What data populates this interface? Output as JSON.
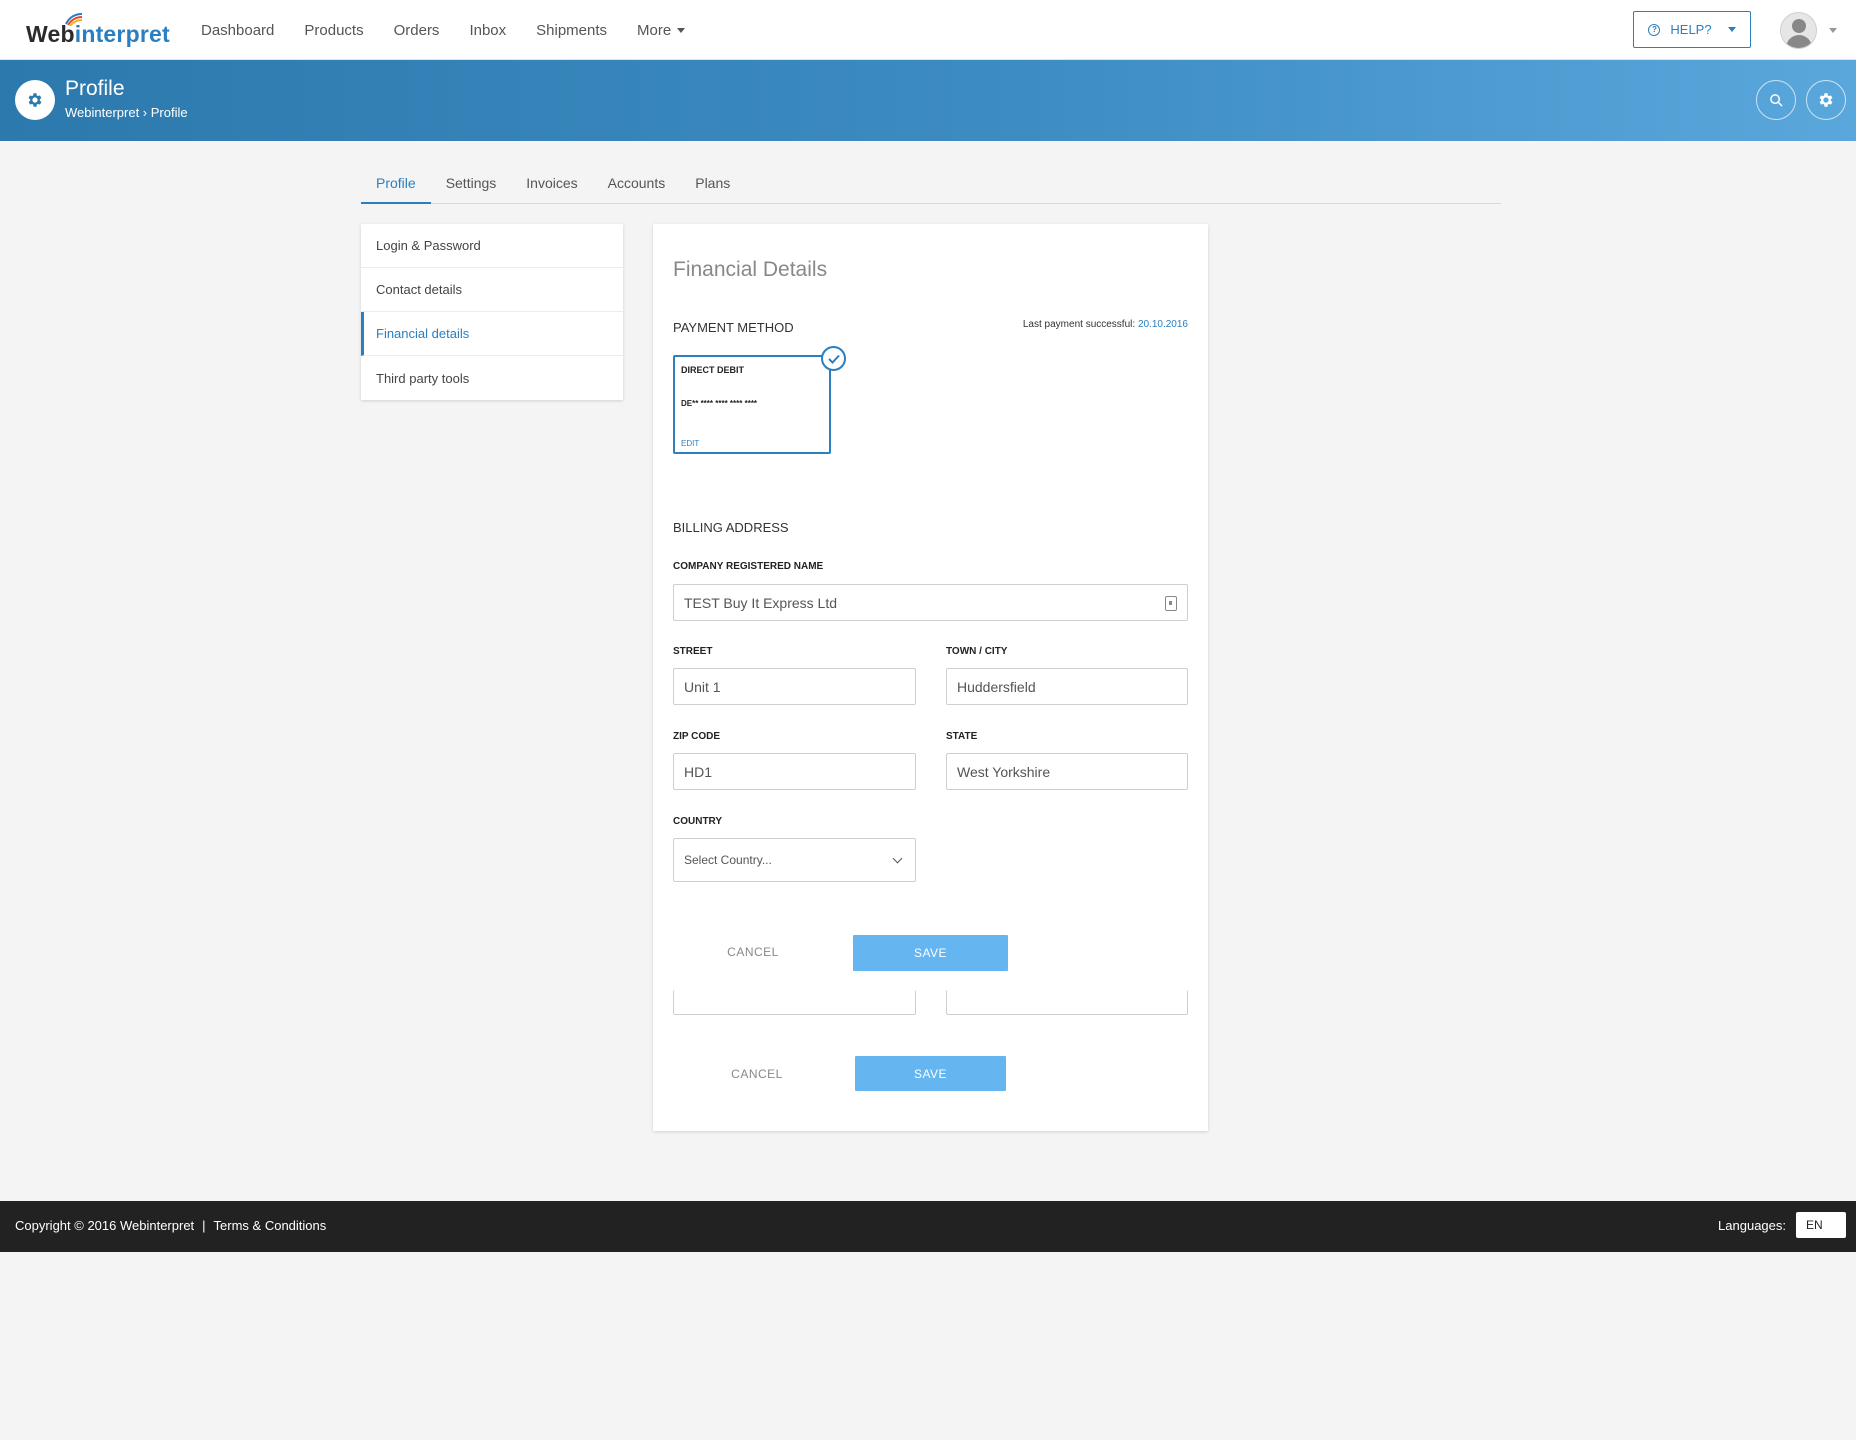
{
  "app": {
    "logo_part1": "Web",
    "logo_part2": "interpret"
  },
  "nav": {
    "items": [
      "Dashboard",
      "Products",
      "Orders",
      "Inbox",
      "Shipments",
      "More"
    ],
    "help_label": "HELP?"
  },
  "header": {
    "title": "Profile",
    "breadcrumb": "Webinterpret › Profile"
  },
  "tabs": [
    "Profile",
    "Settings",
    "Invoices",
    "Accounts",
    "Plans"
  ],
  "active_tab": "Profile",
  "sidebar": {
    "items": [
      {
        "label": "Login & Password"
      },
      {
        "label": "Contact details"
      },
      {
        "label": "Financial details"
      },
      {
        "label": "Third party tools"
      }
    ],
    "active": "Financial details"
  },
  "main": {
    "title": "Financial Details",
    "payment_method_label": "PAYMENT METHOD",
    "last_payment_text": "Last payment successful:",
    "last_payment_date": "20.10.2016",
    "payment_card": {
      "type": "DIRECT DEBIT",
      "number": "DE** **** **** **** ****",
      "edit_label": "EDIT"
    },
    "billing_address_label": "BILLING ADDRESS",
    "fields": {
      "company_label": "COMPANY REGISTERED NAME",
      "company_value": "TEST Buy It Express Ltd",
      "street_label": "STREET",
      "street_value": "Unit 1",
      "town_label": "TOWN / CITY",
      "town_value": "Huddersfield",
      "zip_label": "ZIP CODE",
      "zip_value": "HD1",
      "state_label": "STATE",
      "state_value": "West Yorkshire",
      "country_label": "COUNTRY",
      "country_placeholder": "Select Country..."
    },
    "cancel_label": "CANCEL",
    "save_label": "SAVE"
  },
  "footer": {
    "copyright": "Copyright © 2016 Webinterpret",
    "separator": "|",
    "terms": "Terms & Conditions",
    "languages_label": "Languages:",
    "language_value": "EN"
  },
  "colors": {
    "accent": "#2a7fc0",
    "save_button": "#64b5f0",
    "footer_bg": "#222222"
  }
}
